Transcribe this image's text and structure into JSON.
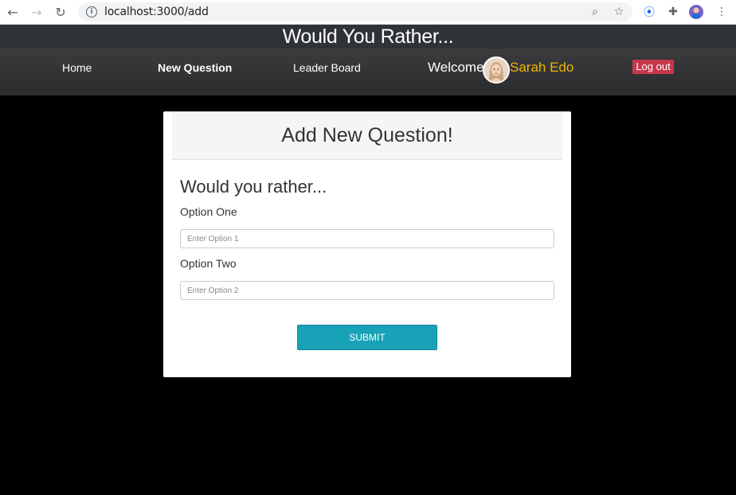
{
  "browser": {
    "url": "localhost:3000/add",
    "back_icon": "arrow-left-icon",
    "forward_icon": "arrow-right-icon",
    "reload_icon": "reload-icon"
  },
  "app": {
    "title": "Would You Rather..."
  },
  "nav": {
    "items": [
      {
        "label": "Home",
        "active": false
      },
      {
        "label": "New Question",
        "active": true
      },
      {
        "label": "Leader Board",
        "active": false
      }
    ],
    "welcome": "Welcome",
    "user_name": "Sarah Edo",
    "logout": "Log out"
  },
  "form": {
    "heading": "Add New Question!",
    "prompt": "Would you rather...",
    "option_one_label": "Option One",
    "option_one_placeholder": "Enter Option 1",
    "option_two_label": "Option Two",
    "option_two_placeholder": "Enter Option 2",
    "submit": "SUBMIT"
  },
  "colors": {
    "accent": "#17a2b8",
    "username": "#f0b400",
    "logout": "#c9374a",
    "page_bg": "#000000"
  }
}
